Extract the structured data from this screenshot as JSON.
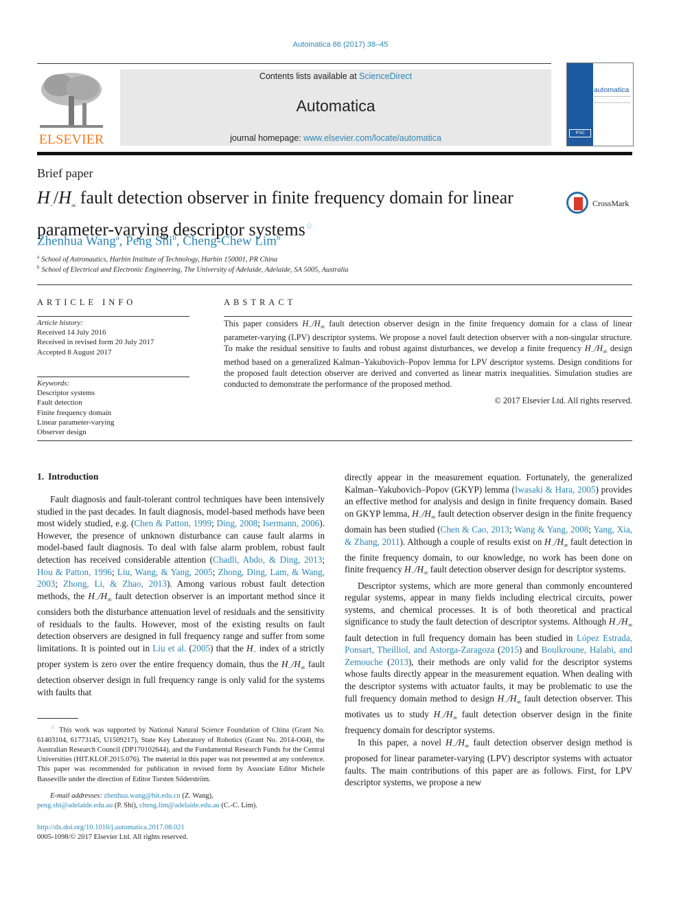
{
  "header": {
    "journal_ref": "Automatica 86 (2017) 38–45",
    "contents_prefix": "Contents lists available at ",
    "contents_link": "ScienceDirect",
    "journal_name": "Automatica",
    "homepage_prefix": "journal homepage: ",
    "homepage_link": "www.elsevier.com/locate/automatica",
    "publisher_logo": "ELSEVIER",
    "cover_title": "automatica",
    "cover_ifac": "IFAC",
    "crossmark": "CrossMark"
  },
  "paper": {
    "type": "Brief paper",
    "title_math": "H",
    "title_sub_minus": "−",
    "title_slash": "/",
    "title_math2": "H",
    "title_sub_inf": "∞",
    "title_rest_line1": " fault detection observer in finite frequency domain for linear",
    "title_line2": "parameter-varying descriptor systems",
    "title_star": "☆",
    "authors": [
      {
        "name": "Zhenhua Wang",
        "sup": "a"
      },
      {
        "name": "Peng Shi",
        "sup": "b"
      },
      {
        "name": "Cheng-Chew Lim",
        "sup": "b"
      }
    ],
    "affiliations": [
      {
        "sup": "a",
        "text": "School of Astronautics, Harbin Institute of Technology, Harbin 150001, PR China"
      },
      {
        "sup": "b",
        "text": "School of Electrical and Electronic Engineering, The University of Adelaide, Adelaide, SA 5005, Australia"
      }
    ]
  },
  "article_info": {
    "heading": "ARTICLE INFO",
    "history_label": "Article history:",
    "history": [
      "Received 14 July 2016",
      "Received in revised form 20 July 2017",
      "Accepted 8 August 2017"
    ],
    "keywords_label": "Keywords:",
    "keywords": [
      "Descriptor systems",
      "Fault detection",
      "Finite frequency domain",
      "Linear parameter-varying",
      "Observer design"
    ]
  },
  "abstract": {
    "heading": "ABSTRACT",
    "p1": "This paper considers ",
    "p2": " fault detection observer design in the finite frequency domain for a class of linear parameter-varying (LPV) descriptor systems. We propose a novel fault detection observer with a non-singular structure. To make the residual sensitive to faults and robust against disturbances, we develop a finite frequency ",
    "p3": " design method based on a generalized Kalman–Yakubovich–Popov lemma for LPV descriptor systems. Design conditions for the proposed fault detection observer are derived and converted as linear matrix inequalities. Simulation studies are conducted to demonstrate the performance of the proposed method.",
    "copyright": "© 2017 Elsevier Ltd. All rights reserved."
  },
  "math": {
    "hminus": "H",
    "minus": "−",
    "slash": "/",
    "hinf": "H",
    "inf": "∞"
  },
  "intro": {
    "number": "1.",
    "heading": "Introduction",
    "left": {
      "a1": "Fault diagnosis and fault-tolerant control techniques have been intensively studied in the past decades. In fault diagnosis, model-based methods have been most widely studied, e.g. (",
      "c1": "Chen & Patton, 1999",
      "a2": "; ",
      "c2": "Ding, 2008",
      "a3": "; ",
      "c3": "Isermann, 2006",
      "a4": "). However, the presence of unknown disturbance can cause fault alarms in model-based fault diagnosis. To deal with false alarm problem, robust fault detection has received considerable attention  (",
      "c4": "Chadli, Abdo, & Ding, 2013",
      "a5": "; ",
      "c5": "Hou & Patton, 1996",
      "a6": "; ",
      "c6": "Liu, Wang, & Yang, 2005",
      "a7": "; ",
      "c7": "Zhong, Ding, Lam, & Wang, 2003",
      "a8": "; ",
      "c8": "Zhong, Li, & Zhao, 2013",
      "a9": "). Among various robust fault detection methods, the ",
      "a10": " fault detection observer is an important method since it considers both the disturbance attenuation level of residuals and the sensitivity of residuals to the faults. However, most of the existing results on fault detection observers are designed in full frequency range and suffer from some limitations. It is pointed out in  ",
      "c9": "Liu et al.",
      "a11": " (",
      "c10": "2005",
      "a12": ") that the ",
      "a13": " index of a strictly proper system is zero over the entire frequency domain, thus the ",
      "a14": " fault detection observer design in full frequency range is only valid for the systems with faults that"
    },
    "right": {
      "b1": "directly appear in the measurement equation. Fortunately, the generalized Kalman–Yakubovich–Popov (GKYP) lemma  (",
      "d1": "Iwasaki & Hara, 2005",
      "b2": ") provides an effective method for analysis and design in finite frequency domain. Based on GKYP lemma, ",
      "b3": " fault detection observer design in the finite frequency domain has been studied (",
      "d2": "Chen & Cao, 2013",
      "b4": "; ",
      "d3": "Wang & Yang, 2008",
      "b5": "; ",
      "d4": "Yang, Xia, & Zhang, 2011",
      "b6": "). Although a couple of results exist on ",
      "b7": " fault detection in the finite frequency domain, to our knowledge, no work has been done on finite frequency ",
      "b8": " fault detection observer design for descriptor systems.",
      "p2a": "Descriptor systems, which are more general than commonly encountered regular systems, appear in many fields including electrical circuits, power systems, and chemical processes. It is of both theoretical and practical significance to study the fault detection of descriptor systems. Although ",
      "p2b": " fault detection in full frequency domain has been studied in  ",
      "d5": "López Estrada, Ponsart, Theilliol, and Astorga-Zaragoza",
      "p2c": " (",
      "d6": "2015",
      "p2d": ") and  ",
      "d7": "Boulkroune, Halabi, and Zemouche",
      "p2e": " (",
      "d8": "2013",
      "p2f": "), their methods are only valid for the descriptor systems whose faults directly appear in the measurement equation. When dealing with the descriptor systems with actuator faults, it may be problematic to use the full frequency domain method to design ",
      "p2g": " fault detection observer. This motivates us to study ",
      "p2h": " fault detection observer design in the finite frequency domain for descriptor systems.",
      "p3a": "In this paper, a novel ",
      "p3b": " fault detection observer design method is proposed for linear parameter-varying (LPV) descriptor systems with actuator faults. The main contributions of this paper are as follows. First, for LPV descriptor systems, we propose a new"
    }
  },
  "footnotes": {
    "star": "☆",
    "funding": "This work was supported by National Natural Science Foundation of China (Grant No. 61403104, 61773145, U1509217), State Key Laboratory of Robotics (Grant No. 2014-O04), the Australian Research Council (DP170102644), and the Fundamental Research Funds for the Central Universities (HIT.KLOF.2015.076). The material in this paper was not presented at any conference. This paper was recommended for publication in revised form by Associate Editor Michele Basseville under the direction of Editor Torsten Söderström.",
    "email_label": "E-mail addresses:",
    "emails": [
      {
        "address": "zhenhua.wang@hit.edu.cn",
        "who": " (Z. Wang),"
      },
      {
        "address": "peng.shi@adelaide.edu.au",
        "who": " (P. Shi), "
      },
      {
        "address": "cheng.lim@adelaide.edu.au",
        "who": " (C.-C. Lim)."
      }
    ],
    "doi": "http://dx.doi.org/10.1016/j.automatica.2017.08.021",
    "issn": "0005-1098/© 2017 Elsevier Ltd. All rights reserved."
  },
  "colors": {
    "link": "#2a86b3",
    "elsevier_orange": "#f07a1a",
    "cover_blue": "#1e5aa0",
    "crossmark_red": "#d93a2b",
    "header_gray": "#e8e8e8"
  }
}
